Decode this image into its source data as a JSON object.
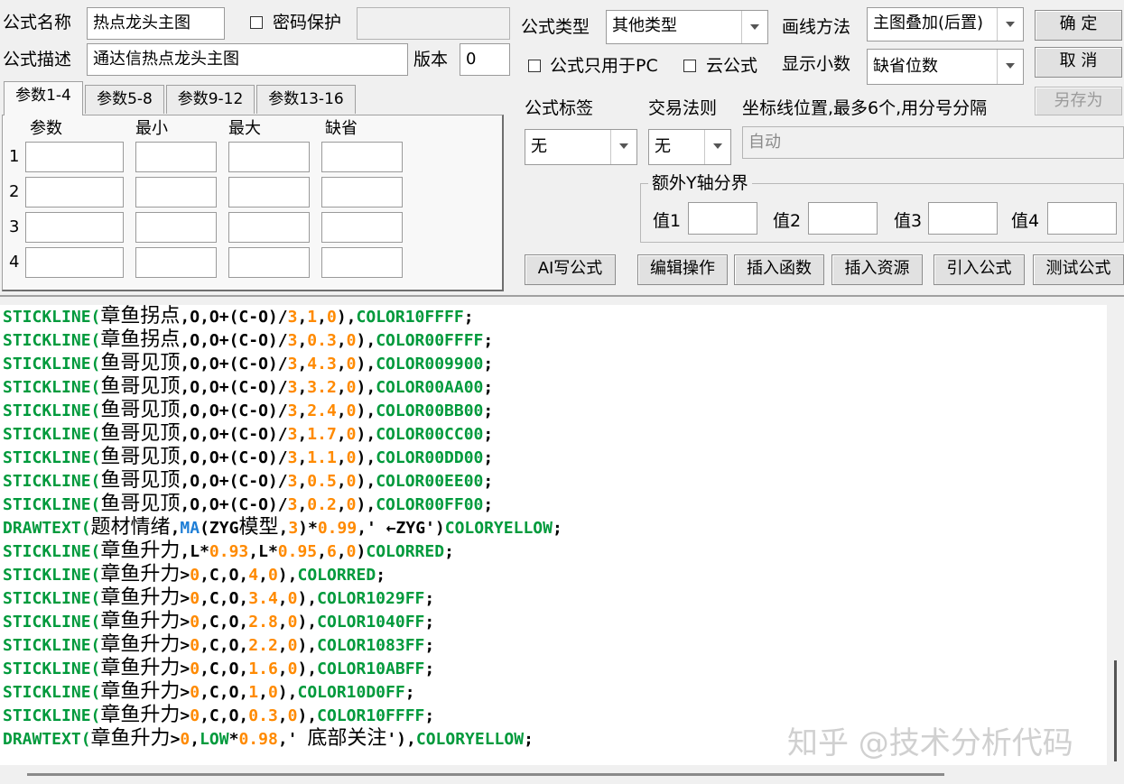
{
  "top": {
    "name_label": "公式名称",
    "name_value": "热点龙头主图",
    "password_label": "密码保护",
    "password_value": "",
    "desc_label": "公式描述",
    "desc_value": "通达信热点龙头主图",
    "version_label": "版本",
    "version_value": "0"
  },
  "tabs": [
    "参数1-4",
    "参数5-8",
    "参数9-12",
    "参数13-16"
  ],
  "params": {
    "headers": [
      "参数",
      "最小",
      "最大",
      "缺省"
    ],
    "rows": [
      "1",
      "2",
      "3",
      "4"
    ]
  },
  "settings": {
    "type_label": "公式类型",
    "type_value": "其他类型",
    "draw_label": "画线方法",
    "draw_value": "主图叠加(后置)",
    "pc_only_label": "公式只用于PC",
    "cloud_label": "云公式",
    "decimals_label": "显示小数",
    "decimals_value": "缺省位数",
    "tag_label": "公式标签",
    "tag_value": "无",
    "rule_label": "交易法则",
    "rule_value": "无",
    "coord_label": "坐标线位置,最多6个,用分号分隔",
    "coord_value": "自动",
    "yaxis_label": "额外Y轴分界",
    "y_values": [
      "值1",
      "值2",
      "值3",
      "值4"
    ]
  },
  "buttons": {
    "ok": "确  定",
    "cancel": "取  消",
    "save_as": "另存为",
    "ai": "AI写公式",
    "edit": "编辑操作",
    "insert_func": "插入函数",
    "insert_res": "插入资源",
    "import": "引入公式",
    "test": "测试公式"
  },
  "code_lines": [
    [
      [
        "kw",
        "STICKLINE("
      ],
      [
        "cn",
        "章鱼拐点"
      ],
      [
        "s",
        ",O,O+(C-O)/"
      ],
      [
        "num",
        "3"
      ],
      [
        "s",
        ","
      ],
      [
        "num",
        "1"
      ],
      [
        "s",
        ","
      ],
      [
        "num",
        "0"
      ],
      [
        "s",
        "),"
      ],
      [
        "kw",
        "COLOR10FFFF"
      ],
      [
        "s",
        ";"
      ]
    ],
    [
      [
        "kw",
        "STICKLINE("
      ],
      [
        "cn",
        "章鱼拐点"
      ],
      [
        "s",
        ",O,O+(C-O)/"
      ],
      [
        "num",
        "3"
      ],
      [
        "s",
        ","
      ],
      [
        "num",
        "0.3"
      ],
      [
        "s",
        ","
      ],
      [
        "num",
        "0"
      ],
      [
        "s",
        "),"
      ],
      [
        "kw",
        "COLOR00FFFF"
      ],
      [
        "s",
        ";"
      ]
    ],
    [
      [
        "kw",
        "STICKLINE("
      ],
      [
        "cn",
        "鱼哥见顶"
      ],
      [
        "s",
        ",O,O+(C-O)/"
      ],
      [
        "num",
        "3"
      ],
      [
        "s",
        ","
      ],
      [
        "num",
        "4.3"
      ],
      [
        "s",
        ","
      ],
      [
        "num",
        "0"
      ],
      [
        "s",
        "),"
      ],
      [
        "kw",
        "COLOR009900"
      ],
      [
        "s",
        ";"
      ]
    ],
    [
      [
        "kw",
        "STICKLINE("
      ],
      [
        "cn",
        "鱼哥见顶"
      ],
      [
        "s",
        ",O,O+(C-O)/"
      ],
      [
        "num",
        "3"
      ],
      [
        "s",
        ","
      ],
      [
        "num",
        "3.2"
      ],
      [
        "s",
        ","
      ],
      [
        "num",
        "0"
      ],
      [
        "s",
        "),"
      ],
      [
        "kw",
        "COLOR00AA00"
      ],
      [
        "s",
        ";"
      ]
    ],
    [
      [
        "kw",
        "STICKLINE("
      ],
      [
        "cn",
        "鱼哥见顶"
      ],
      [
        "s",
        ",O,O+(C-O)/"
      ],
      [
        "num",
        "3"
      ],
      [
        "s",
        ","
      ],
      [
        "num",
        "2.4"
      ],
      [
        "s",
        ","
      ],
      [
        "num",
        "0"
      ],
      [
        "s",
        "),"
      ],
      [
        "kw",
        "COLOR00BB00"
      ],
      [
        "s",
        ";"
      ]
    ],
    [
      [
        "kw",
        "STICKLINE("
      ],
      [
        "cn",
        "鱼哥见顶"
      ],
      [
        "s",
        ",O,O+(C-O)/"
      ],
      [
        "num",
        "3"
      ],
      [
        "s",
        ","
      ],
      [
        "num",
        "1.7"
      ],
      [
        "s",
        ","
      ],
      [
        "num",
        "0"
      ],
      [
        "s",
        "),"
      ],
      [
        "kw",
        "COLOR00CC00"
      ],
      [
        "s",
        ";"
      ]
    ],
    [
      [
        "kw",
        "STICKLINE("
      ],
      [
        "cn",
        "鱼哥见顶"
      ],
      [
        "s",
        ",O,O+(C-O)/"
      ],
      [
        "num",
        "3"
      ],
      [
        "s",
        ","
      ],
      [
        "num",
        "1.1"
      ],
      [
        "s",
        ","
      ],
      [
        "num",
        "0"
      ],
      [
        "s",
        "),"
      ],
      [
        "kw",
        "COLOR00DD00"
      ],
      [
        "s",
        ";"
      ]
    ],
    [
      [
        "kw",
        "STICKLINE("
      ],
      [
        "cn",
        "鱼哥见顶"
      ],
      [
        "s",
        ",O,O+(C-O)/"
      ],
      [
        "num",
        "3"
      ],
      [
        "s",
        ","
      ],
      [
        "num",
        "0.5"
      ],
      [
        "s",
        ","
      ],
      [
        "num",
        "0"
      ],
      [
        "s",
        "),"
      ],
      [
        "kw",
        "COLOR00EE00"
      ],
      [
        "s",
        ";"
      ]
    ],
    [
      [
        "kw",
        "STICKLINE("
      ],
      [
        "cn",
        "鱼哥见顶"
      ],
      [
        "s",
        ",O,O+(C-O)/"
      ],
      [
        "num",
        "3"
      ],
      [
        "s",
        ","
      ],
      [
        "num",
        "0.2"
      ],
      [
        "s",
        ","
      ],
      [
        "num",
        "0"
      ],
      [
        "s",
        "),"
      ],
      [
        "kw",
        "COLOR00FF00"
      ],
      [
        "s",
        ";"
      ]
    ],
    [
      [
        "kw",
        "DRAWTEXT("
      ],
      [
        "cn",
        "题材情绪"
      ],
      [
        "s",
        ","
      ],
      [
        "fn",
        "MA"
      ],
      [
        "s",
        "(ZYG"
      ],
      [
        "cn",
        "模型"
      ],
      [
        "s",
        ","
      ],
      [
        "num",
        "3"
      ],
      [
        "s",
        ")*"
      ],
      [
        "num",
        "0.99"
      ],
      [
        "s",
        ",' ←ZYG')"
      ],
      [
        "kw",
        "COLORYELLOW"
      ],
      [
        "s",
        ";"
      ]
    ],
    [
      [
        "kw",
        "STICKLINE("
      ],
      [
        "cn",
        "章鱼升力"
      ],
      [
        "s",
        ",L*"
      ],
      [
        "num",
        "0.93"
      ],
      [
        "s",
        ",L*"
      ],
      [
        "num",
        "0.95"
      ],
      [
        "s",
        ","
      ],
      [
        "num",
        "6"
      ],
      [
        "s",
        ","
      ],
      [
        "num",
        "0"
      ],
      [
        "s",
        ")"
      ],
      [
        "kw",
        "COLORRED"
      ],
      [
        "s",
        ";"
      ]
    ],
    [
      [
        "kw",
        "STICKLINE("
      ],
      [
        "cn",
        "章鱼升力"
      ],
      [
        "s",
        ">"
      ],
      [
        "num",
        "0"
      ],
      [
        "s",
        ",C,O,"
      ],
      [
        "num",
        "4"
      ],
      [
        "s",
        ","
      ],
      [
        "num",
        "0"
      ],
      [
        "s",
        "),"
      ],
      [
        "kw",
        "COLORRED"
      ],
      [
        "s",
        ";"
      ]
    ],
    [
      [
        "kw",
        "STICKLINE("
      ],
      [
        "cn",
        "章鱼升力"
      ],
      [
        "s",
        ">"
      ],
      [
        "num",
        "0"
      ],
      [
        "s",
        ",C,O,"
      ],
      [
        "num",
        "3.4"
      ],
      [
        "s",
        ","
      ],
      [
        "num",
        "0"
      ],
      [
        "s",
        "),"
      ],
      [
        "kw",
        "COLOR1029FF"
      ],
      [
        "s",
        ";"
      ]
    ],
    [
      [
        "kw",
        "STICKLINE("
      ],
      [
        "cn",
        "章鱼升力"
      ],
      [
        "s",
        ">"
      ],
      [
        "num",
        "0"
      ],
      [
        "s",
        ",C,O,"
      ],
      [
        "num",
        "2.8"
      ],
      [
        "s",
        ","
      ],
      [
        "num",
        "0"
      ],
      [
        "s",
        "),"
      ],
      [
        "kw",
        "COLOR1040FF"
      ],
      [
        "s",
        ";"
      ]
    ],
    [
      [
        "kw",
        "STICKLINE("
      ],
      [
        "cn",
        "章鱼升力"
      ],
      [
        "s",
        ">"
      ],
      [
        "num",
        "0"
      ],
      [
        "s",
        ",C,O,"
      ],
      [
        "num",
        "2.2"
      ],
      [
        "s",
        ","
      ],
      [
        "num",
        "0"
      ],
      [
        "s",
        "),"
      ],
      [
        "kw",
        "COLOR1083FF"
      ],
      [
        "s",
        ";"
      ]
    ],
    [
      [
        "kw",
        "STICKLINE("
      ],
      [
        "cn",
        "章鱼升力"
      ],
      [
        "s",
        ">"
      ],
      [
        "num",
        "0"
      ],
      [
        "s",
        ",C,O,"
      ],
      [
        "num",
        "1.6"
      ],
      [
        "s",
        ","
      ],
      [
        "num",
        "0"
      ],
      [
        "s",
        "),"
      ],
      [
        "kw",
        "COLOR10ABFF"
      ],
      [
        "s",
        ";"
      ]
    ],
    [
      [
        "kw",
        "STICKLINE("
      ],
      [
        "cn",
        "章鱼升力"
      ],
      [
        "s",
        ">"
      ],
      [
        "num",
        "0"
      ],
      [
        "s",
        ",C,O,"
      ],
      [
        "num",
        "1"
      ],
      [
        "s",
        ","
      ],
      [
        "num",
        "0"
      ],
      [
        "s",
        "),"
      ],
      [
        "kw",
        "COLOR10D0FF"
      ],
      [
        "s",
        ";"
      ]
    ],
    [
      [
        "kw",
        "STICKLINE("
      ],
      [
        "cn",
        "章鱼升力"
      ],
      [
        "s",
        ">"
      ],
      [
        "num",
        "0"
      ],
      [
        "s",
        ",C,O,"
      ],
      [
        "num",
        "0.3"
      ],
      [
        "s",
        ","
      ],
      [
        "num",
        "0"
      ],
      [
        "s",
        "),"
      ],
      [
        "kw",
        "COLOR10FFFF"
      ],
      [
        "s",
        ";"
      ]
    ],
    [
      [
        "kw",
        "DRAWTEXT("
      ],
      [
        "cn",
        "章鱼升力"
      ],
      [
        "s",
        ">"
      ],
      [
        "num",
        "0"
      ],
      [
        "s",
        ","
      ],
      [
        "kw",
        "LOW"
      ],
      [
        "s",
        "*"
      ],
      [
        "num",
        "0.98"
      ],
      [
        "s",
        ",' "
      ],
      [
        "cn",
        "底部关注"
      ],
      [
        "s",
        "'),"
      ],
      [
        "kw",
        "COLORYELLOW"
      ],
      [
        "s",
        ";"
      ]
    ]
  ],
  "watermark": "知乎 @技术分析代码",
  "colors": {
    "keyword": "#009a3c",
    "number": "#ff8a00",
    "function": "#1e7ed6"
  }
}
